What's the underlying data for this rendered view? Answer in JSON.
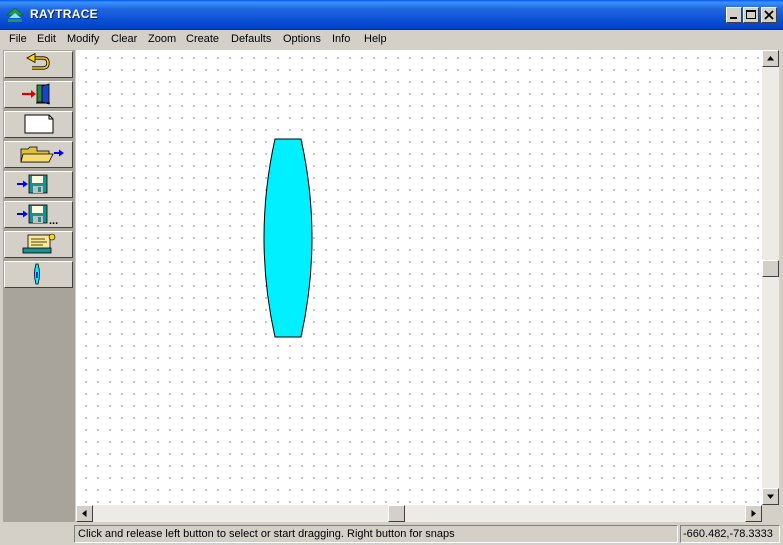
{
  "window": {
    "title": "RAYTRACE",
    "icons": [
      "app-icon",
      "minimize-icon",
      "maximize-icon",
      "close-icon"
    ]
  },
  "menubar": {
    "items": [
      "File",
      "Edit",
      "Modify",
      "Clear",
      "Zoom",
      "Create",
      "Defaults",
      "Options",
      "Info",
      "Help"
    ]
  },
  "toolbar": {
    "buttons": [
      {
        "icon": "undo-arrow-icon"
      },
      {
        "icon": "exit-door-icon"
      },
      {
        "icon": "new-page-icon"
      },
      {
        "icon": "open-folder-icon"
      },
      {
        "icon": "save-disk-icon"
      },
      {
        "icon": "save-as-disk-icon",
        "suffix": "..."
      },
      {
        "icon": "print-scroll-icon"
      },
      {
        "icon": "lens-tool-icon"
      }
    ]
  },
  "canvas": {
    "objects": [
      {
        "type": "lens",
        "fill": "#00f0ff"
      }
    ]
  },
  "colors": {
    "title_bar": "#0a4fd4",
    "face": "#d4d0c8",
    "canvas_bg": "#ffffff",
    "grid_dots": "#9a9a9a",
    "lens": "#00f0ff"
  },
  "statusbar": {
    "message": "Click and release left button to select or start dragging. Right button for snaps",
    "coordinates": "-660.482,-78.3333"
  }
}
